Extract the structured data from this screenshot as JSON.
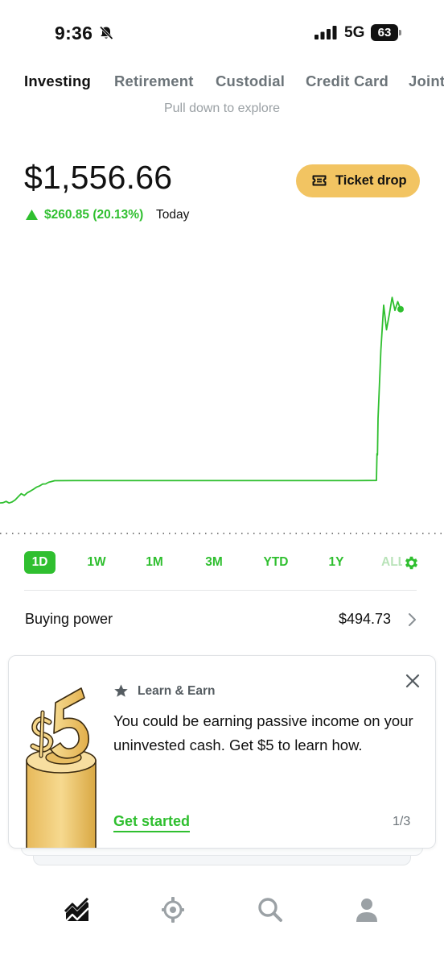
{
  "status_bar": {
    "time": "9:36",
    "network": "5G",
    "battery": "63"
  },
  "tabs": [
    "Investing",
    "Retirement",
    "Custodial",
    "Credit Card",
    "Joint"
  ],
  "pull_hint": "Pull down to explore",
  "portfolio": {
    "value": "$1,556.66",
    "change": "$260.85 (20.13%)",
    "change_period": "Today",
    "direction": "up"
  },
  "ticket_button": {
    "label": "Ticket drop"
  },
  "chart_data": {
    "type": "line",
    "series": [
      {
        "values": [
          1293.2,
          1293.5,
          1295.3,
          1293.1,
          1294.5,
          1297.2,
          1301.6,
          1305.8,
          1303.4,
          1307.1,
          1309.3,
          1311.8,
          1314.6,
          1316.2,
          1318.8,
          1319.1,
          1321.2,
          1322.3,
          1323.4,
          1323.5,
          1323.5,
          1323.5,
          1323.5,
          1323.5,
          1323.5,
          1323.5,
          1323.5,
          1323.5,
          1323.5,
          1323.5,
          1323.5,
          1323.5,
          1323.5,
          1323.5,
          1323.8,
          1360.2,
          1358.4,
          1408.2,
          1500.6,
          1562.3,
          1528.7,
          1549.6,
          1572.8,
          1555.1,
          1567.0,
          1556.7
        ]
      }
    ],
    "baseline": 1295.81,
    "baseline_style": "dotted",
    "color": "#2fbf2f"
  },
  "ranges": {
    "items": [
      "1D",
      "1W",
      "1M",
      "3M",
      "YTD",
      "1Y",
      "ALL"
    ],
    "selected": "1D"
  },
  "buying_power": {
    "label": "Buying power",
    "value": "$494.73"
  },
  "card": {
    "eyebrow": "Learn & Earn",
    "body": "You could be earning passive income on your uninvested cash. Get $5 to learn how.",
    "cta": "Get started",
    "pager": "1/3",
    "illustration_text": "$5"
  },
  "bottom_nav": [
    {
      "icon": "investing-chart-icon"
    },
    {
      "icon": "crypto-icon"
    },
    {
      "icon": "search-icon"
    },
    {
      "icon": "account-icon"
    }
  ],
  "colors": {
    "accent_green": "#2fbf2f",
    "ticket_yellow": "#f2c462",
    "text_muted": "#6c7479"
  }
}
